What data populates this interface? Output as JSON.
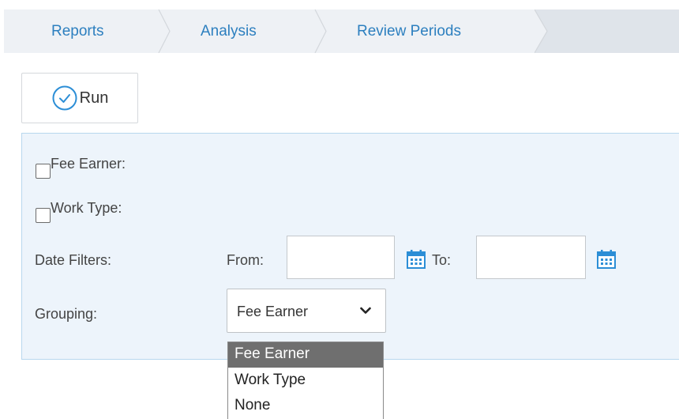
{
  "breadcrumb": {
    "items": [
      {
        "label": "Reports"
      },
      {
        "label": "Analysis"
      },
      {
        "label": "Review Periods"
      }
    ]
  },
  "toolbar": {
    "run_label": "Run",
    "run_icon": "check-circle-icon"
  },
  "filters": {
    "fee_earner_label": "Fee Earner:",
    "fee_earner_checked": false,
    "work_type_label": "Work Type:",
    "work_type_checked": false,
    "date_filters_label": "Date Filters:",
    "from_label": "From:",
    "from_value": "",
    "to_label": "To:",
    "to_value": "",
    "calendar_icon": "calendar-icon",
    "grouping_label": "Grouping:",
    "grouping_selected": "Fee Earner",
    "grouping_options": [
      "Fee Earner",
      "Work Type",
      "None"
    ]
  },
  "colors": {
    "link": "#2c7fbf",
    "breadcrumb_bg": "#eef1f5",
    "panel_bg": "#edf4fb",
    "panel_border": "#b8d7ee",
    "selected_option_bg": "#6f6f6f"
  }
}
